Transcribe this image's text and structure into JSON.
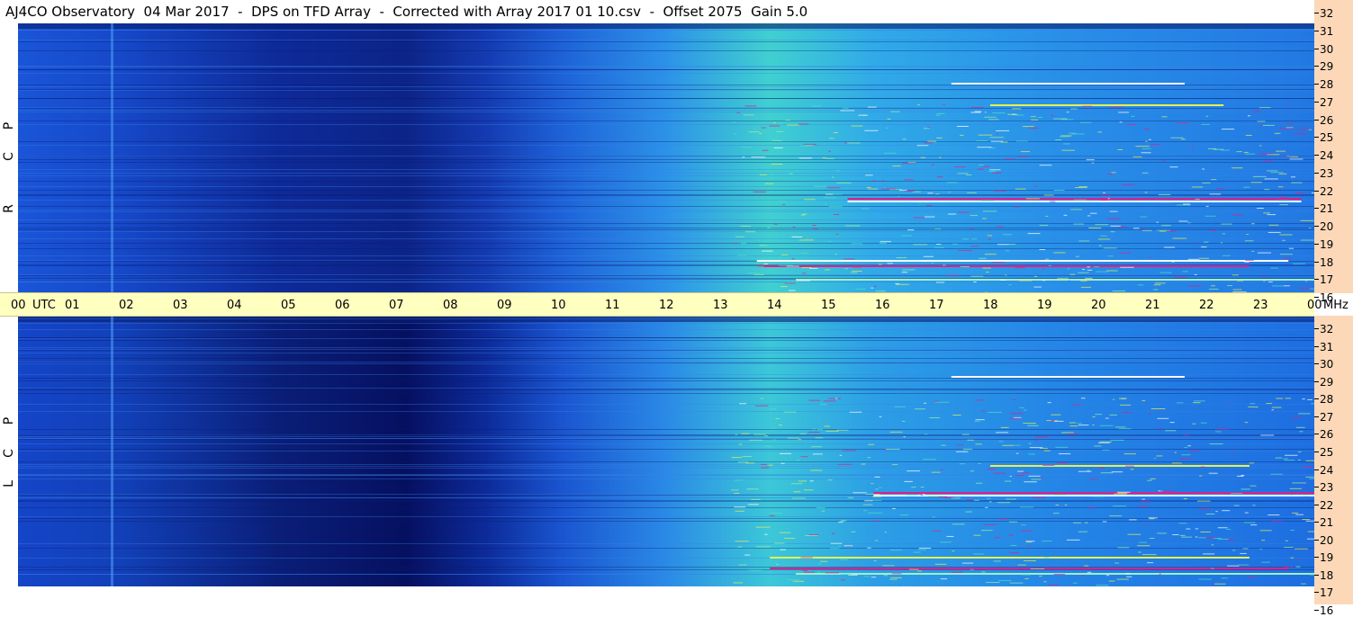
{
  "title": "AJ4CO Observatory  04 Mar 2017  -  DPS on TFD Array  -  Corrected with Array 2017 01 10.csv  -  Offset 2075  Gain 5.0",
  "panels": [
    {
      "polarization": "RCP",
      "letters": [
        "R",
        "C",
        "P"
      ]
    },
    {
      "polarization": "LCP",
      "letters": [
        "L",
        "C",
        "P"
      ]
    }
  ],
  "time_axis": {
    "labels": [
      "00",
      "UTC",
      "01",
      "02",
      "03",
      "04",
      "05",
      "06",
      "07",
      "08",
      "09",
      "10",
      "11",
      "12",
      "13",
      "14",
      "15",
      "16",
      "17",
      "18",
      "19",
      "20",
      "21",
      "22",
      "23",
      "00",
      "MHz"
    ]
  },
  "freq_axis": {
    "labels": [
      "32",
      "31",
      "30",
      "29",
      "28",
      "27",
      "26",
      "25",
      "24",
      "23",
      "22",
      "21",
      "20",
      "19",
      "18",
      "17",
      "16"
    ]
  },
  "chart_data": {
    "type": "heatmap",
    "title": "AJ4CO Observatory  04 Mar 2017  -  DPS on TFD Array  -  Corrected with Array 2017 01 10.csv  -  Offset 2075  Gain 5.0",
    "x_ticks": [
      "00",
      "01",
      "02",
      "03",
      "04",
      "05",
      "06",
      "07",
      "08",
      "09",
      "10",
      "11",
      "12",
      "13",
      "14",
      "15",
      "16",
      "17",
      "18",
      "19",
      "20",
      "21",
      "22",
      "23",
      "00"
    ],
    "x_unit": "UTC",
    "y_unit": "MHz",
    "y_range": [
      16,
      32
    ],
    "series": [
      {
        "name": "RCP"
      },
      {
        "name": "LCP"
      }
    ],
    "colors": {
      "low": "#001060",
      "mid": "#1e64e6",
      "high": "#50e6b4",
      "peak": "#ffffff",
      "spike_magenta": "#e0208c",
      "spike_yellow": "#e6f050"
    }
  }
}
